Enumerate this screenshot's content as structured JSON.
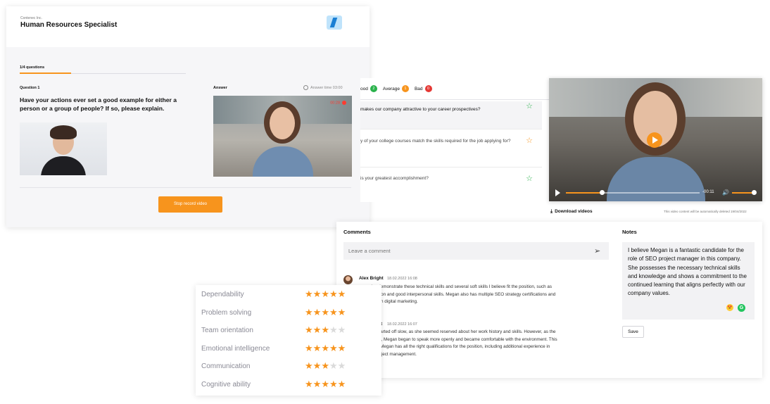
{
  "interview": {
    "company": "Contenec Inc.",
    "job_title": "Human Resources Specialist",
    "question_count": "1/4 questions",
    "question_label": "Question 1",
    "question_text": "Have your actions ever set a good example for either a person or a group of people? If so, please explain.",
    "answer_label": "Answer",
    "answer_time": "Answer time 03:00",
    "rec_time": "00:28",
    "stop_button": "Stop record video"
  },
  "ratings_legend": {
    "good_label": "ood",
    "good_count": "2",
    "average_label": "Average",
    "average_count": "1",
    "bad_label": "Bad",
    "bad_count": "0"
  },
  "questions": [
    {
      "text": "makes our company attractive to your career prospectives?",
      "star": "green"
    },
    {
      "text": "y of your college courses match the skills required for the job applying for?",
      "star": "orange"
    },
    {
      "text": "is your greatest accomplishment?",
      "star": "green"
    }
  ],
  "player": {
    "remaining": "-00:11",
    "progress": 0.27,
    "volume": 1.0
  },
  "download": {
    "label": "Download videos",
    "notice": "This video content will be automatically deleted 19/04/2022"
  },
  "comments": {
    "title": "Comments",
    "placeholder": "Leave a comment",
    "items": [
      {
        "author": "Alex Bright",
        "time": "18.02.2022 16:08",
        "lines": [
          "ous roles demonstrate these technical skills and several soft skills I believe fit the position, such as",
          "determination and good interpersonal skills. Megan also has multiple SEO strategy certifications and",
          "r's degree in digital marketing."
        ]
      },
      {
        "author": "t",
        "time": "18.02.2022 16:07",
        "lines": [
          "nterview started off slow, as she seemed reserved about her work history and skills. However, as the",
          "progressed, Megan began to speak more openly and became comfortable with the environment. This",
          "arned that Megan has all the right qualifications for the position, including additional experience in",
          "ent and project management."
        ]
      }
    ]
  },
  "notes": {
    "title": "Notes",
    "text": "I believe Megan is a fantastic candidate for the role of SEO project manager in this company. She possesses the necessary technical skills and knowledge and shows a commitment to the continued learning that aligns perfectly with our company values.",
    "save": "Save"
  },
  "skills": [
    {
      "name": "Dependability",
      "rating": 5
    },
    {
      "name": "Problem solving",
      "rating": 5
    },
    {
      "name": "Team orientation",
      "rating": 3
    },
    {
      "name": "Emotional intelligence",
      "rating": 5
    },
    {
      "name": "Communication",
      "rating": 3
    },
    {
      "name": "Cognitive ability",
      "rating": 5
    }
  ],
  "colors": {
    "accent": "#f7941d",
    "good": "#2bb24c",
    "average": "#f7941d",
    "bad": "#e53935"
  }
}
